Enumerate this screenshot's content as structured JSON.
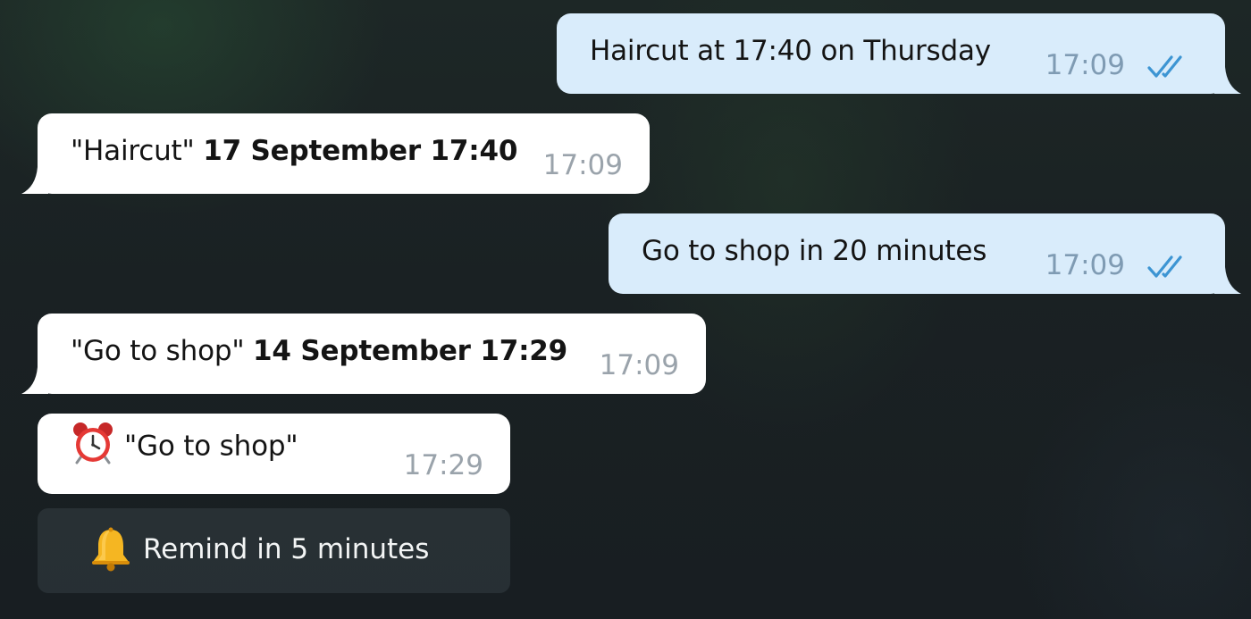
{
  "messages": [
    {
      "direction": "outgoing",
      "text": "Haircut at 17:40 on Thursday",
      "time": "17:09",
      "status_icon": "double-check-icon"
    },
    {
      "direction": "incoming",
      "quoted": "\"Haircut\"",
      "bold": "17 September 17:40",
      "time": "17:09"
    },
    {
      "direction": "outgoing",
      "text": "Go to shop in 20 minutes",
      "time": "17:09",
      "status_icon": "double-check-icon"
    },
    {
      "direction": "incoming",
      "quoted": "\"Go to shop\"",
      "bold": "14 September 17:29",
      "time": "17:09"
    },
    {
      "direction": "incoming",
      "icon": "alarm-clock-icon",
      "text": "\"Go to shop\"",
      "time": "17:29"
    }
  ],
  "inline_button": {
    "icon": "bell-icon",
    "label": "Remind in 5 minutes"
  },
  "colors": {
    "outgoing_bubble": "#d9ecfb",
    "incoming_bubble": "#ffffff",
    "check_mark": "#3d95d3",
    "background": "#1a2123"
  }
}
